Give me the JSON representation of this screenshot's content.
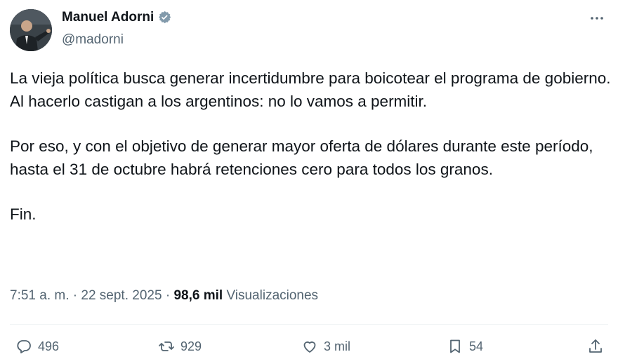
{
  "author": {
    "name": "Manuel Adorni",
    "handle": "@madorni"
  },
  "tweet": {
    "paragraphs": [
      "La vieja política busca generar incertidumbre para boicotear el programa de gobierno. Al hacerlo castigan a los argentinos: no lo vamos a permitir.",
      "Por eso, y con el objetivo de generar mayor oferta de dólares durante este período, hasta el 31 de octubre habrá retenciones cero para todos los granos.",
      "Fin."
    ],
    "time": "7:51 a. m.",
    "sep": "·",
    "date": "22 sept. 2025",
    "views_count": "98,6 mil",
    "views_label": "Visualizaciones"
  },
  "actions": {
    "replies": "496",
    "reposts": "929",
    "likes": "3 mil",
    "bookmarks": "54"
  },
  "colors": {
    "verified": "#829aab",
    "muted": "#536471",
    "text": "#0f1419"
  }
}
